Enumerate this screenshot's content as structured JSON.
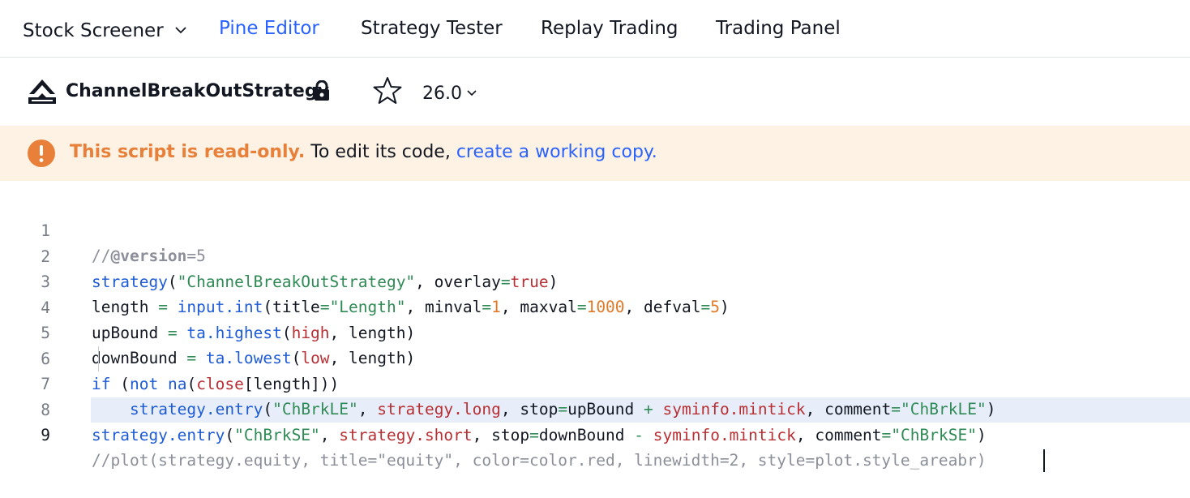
{
  "tabs": [
    {
      "label": "Stock Screener",
      "has_dropdown": true
    },
    {
      "label": "Pine Editor",
      "active": true
    },
    {
      "label": "Strategy Tester"
    },
    {
      "label": "Replay Trading"
    },
    {
      "label": "Trading Panel"
    }
  ],
  "script": {
    "title": "ChannelBreakOutStrategy",
    "version": "26.0",
    "icons": [
      "logo-icon",
      "lock-icon",
      "star-icon",
      "chevron-down-icon"
    ]
  },
  "banner": {
    "warning": "This script is read-only.",
    "text": " To edit its code, ",
    "link": "create a working copy.",
    "icon": "exclamation-icon",
    "color": "#e8803a"
  },
  "editor": {
    "current_line": 9,
    "lines": [
      {
        "n": "1"
      },
      {
        "n": "2"
      },
      {
        "n": "3"
      },
      {
        "n": "4"
      },
      {
        "n": "5"
      },
      {
        "n": "6"
      },
      {
        "n": "7"
      },
      {
        "n": "8"
      },
      {
        "n": "9"
      }
    ],
    "code": {
      "l1": [
        "//",
        "@version",
        "=5"
      ],
      "l2": [
        "strategy",
        "(",
        "\"ChannelBreakOutStrategy\"",
        ", overlay",
        "=",
        "true",
        ")"
      ],
      "l3": [
        "length ",
        "=",
        " ",
        "input.int",
        "(title",
        "=",
        "\"Length\"",
        ", minval",
        "=",
        "1",
        ", maxval",
        "=",
        "1000",
        ", defval",
        "=",
        "5",
        ")"
      ],
      "l4": [
        "upBound ",
        "=",
        " ",
        "ta.highest",
        "(",
        "high",
        ", length)"
      ],
      "l5": [
        "downBound ",
        "=",
        " ",
        "ta.lowest",
        "(",
        "low",
        ", length)"
      ],
      "l6": [
        "if",
        " (",
        "not",
        " ",
        "na",
        "(",
        "close",
        "[length]))"
      ],
      "l7": [
        "    ",
        "strategy.entry",
        "(",
        "\"ChBrkLE\"",
        ", ",
        "strategy.long",
        ", stop",
        "=",
        "upBound ",
        "+",
        " ",
        "syminfo.mintick",
        ", comment",
        "=",
        "\"ChBrkLE\"",
        ")"
      ],
      "l8": [
        "strategy.entry",
        "(",
        "\"ChBrkSE\"",
        ", ",
        "strategy.short",
        ", stop",
        "=",
        "downBound ",
        "-",
        " ",
        "syminfo.mintick",
        ", comment",
        "=",
        "\"ChBrkSE\"",
        ")"
      ],
      "l9": [
        "//plot(strategy.equity, title=\"equity\", color=color.red, linewidth=2, style=plot.style_areabr)"
      ]
    }
  },
  "colors": {
    "accent": "#2962ff",
    "keyword": "#1e5bd6",
    "string": "#2f8a55",
    "number": "#e07a28",
    "builtin_var": "#b82f34",
    "comment": "#8c8f99"
  }
}
